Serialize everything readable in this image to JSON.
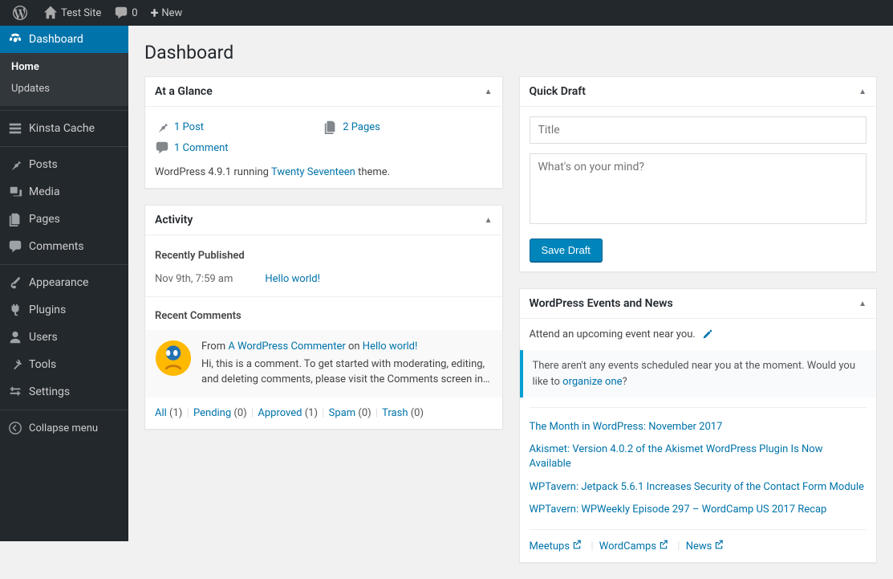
{
  "adminbar": {
    "site_name": "Test Site",
    "comments_count": "0",
    "new_label": "New"
  },
  "sidebar": {
    "items": [
      {
        "label": "Dashboard"
      },
      {
        "label": "Kinsta Cache"
      },
      {
        "label": "Posts"
      },
      {
        "label": "Media"
      },
      {
        "label": "Pages"
      },
      {
        "label": "Comments"
      },
      {
        "label": "Appearance"
      },
      {
        "label": "Plugins"
      },
      {
        "label": "Users"
      },
      {
        "label": "Tools"
      },
      {
        "label": "Settings"
      }
    ],
    "submenu": {
      "home": "Home",
      "updates": "Updates"
    },
    "collapse": "Collapse menu"
  },
  "page": {
    "title": "Dashboard"
  },
  "glance": {
    "title": "At a Glance",
    "posts": "1 Post",
    "pages": "2 Pages",
    "comments": "1 Comment",
    "version_prefix": "WordPress 4.9.1 running ",
    "theme": "Twenty Seventeen",
    "version_suffix": " theme."
  },
  "activity": {
    "title": "Activity",
    "recently_published": "Recently Published",
    "pub_date": "Nov 9th, 7:59 am",
    "pub_title": "Hello world!",
    "recent_comments": "Recent Comments",
    "comment_from_prefix": "From ",
    "comment_author": "A WordPress Commenter",
    "comment_on": " on ",
    "comment_post": "Hello world!",
    "comment_body": "Hi, this is a comment. To get started with moderating, editing, and deleting comments, please visit the Comments screen in…",
    "filters": {
      "all": "All",
      "all_count": "(1)",
      "pending": "Pending",
      "pending_count": "(0)",
      "approved": "Approved",
      "approved_count": "(1)",
      "spam": "Spam",
      "spam_count": "(0)",
      "trash": "Trash",
      "trash_count": "(0)"
    }
  },
  "quickdraft": {
    "title": "Quick Draft",
    "title_placeholder": "Title",
    "content_placeholder": "What's on your mind?",
    "save": "Save Draft"
  },
  "events": {
    "title": "WordPress Events and News",
    "attend": "Attend an upcoming event near you.",
    "none_prefix": "There aren't any events scheduled near you at the moment. Would you like to ",
    "organize": "organize one",
    "none_suffix": "?",
    "news": [
      "The Month in WordPress: November 2017",
      "Akismet: Version 4.0.2 of the Akismet WordPress Plugin Is Now Available",
      "WPTavern: Jetpack 5.6.1 Increases Security of the Contact Form Module",
      "WPTavern: WPWeekly Episode 297 – WordCamp US 2017 Recap"
    ],
    "footer": {
      "meetups": "Meetups",
      "wordcamps": "WordCamps",
      "news": "News"
    }
  }
}
